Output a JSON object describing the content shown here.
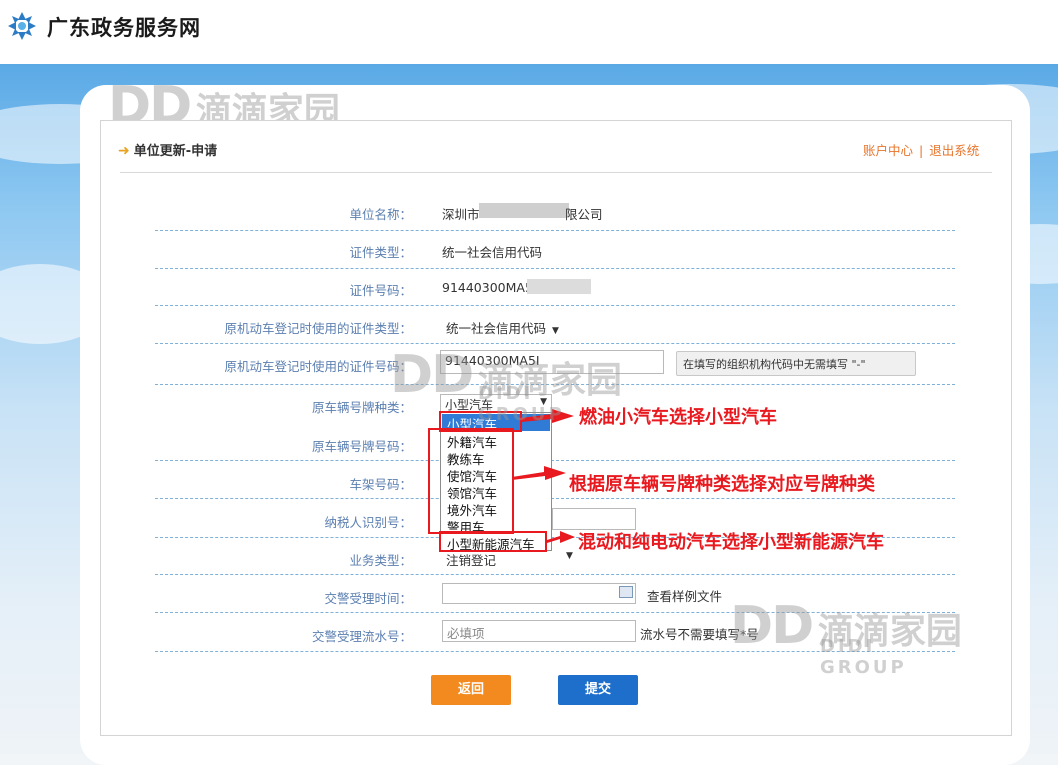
{
  "header": {
    "site_title": "广东政务服务网"
  },
  "page": {
    "title": "单位更新-申请",
    "account_center": "账户中心",
    "separator": "|",
    "logout": "退出系统"
  },
  "form": {
    "unit_name_label": "单位名称：",
    "unit_name_prefix": "深圳市",
    "unit_name_suffix": "限公司",
    "cert_type_label": "证件类型：",
    "cert_type_value": "统一社会信用代码",
    "cert_no_label": "证件号码：",
    "cert_no_value": "91440300MA5",
    "orig_cert_type_label": "原机动车登记时使用的证件类型：",
    "orig_cert_type_value": "统一社会信用代码",
    "orig_cert_no_label": "原机动车登记时使用的证件号码：",
    "orig_cert_no_value": "91440300MA5I",
    "orig_cert_no_hint": "在填写的组织机构代码中无需填写 \"-\"",
    "plate_type_label": "原车辆号牌种类：",
    "plate_type_selected": "小型汽车",
    "plate_no_label": "原车辆号牌号码：",
    "vin_label": "车架号码：",
    "taxpayer_label": "纳税人识别号：",
    "business_type_label": "业务类型：",
    "business_type_value": "注销登记",
    "police_time_label": "交警受理时间：",
    "view_sample": "查看样例文件",
    "police_serial_label": "交警受理流水号：",
    "police_serial_placeholder": "必填项",
    "police_serial_hint": "流水号不需要填写*号"
  },
  "dropdown": {
    "options": [
      "小型汽车",
      "外籍汽车",
      "教练车",
      "使馆汽车",
      "领馆汽车",
      "境外汽车",
      "警用车",
      "小型新能源汽车"
    ],
    "selected_index": 0
  },
  "annotations": {
    "a1": "燃油小汽车选择小型汽车",
    "a2": "根据原车辆号牌种类选择对应号牌种类",
    "a3": "混动和纯电动汽车选择小型新能源汽车"
  },
  "buttons": {
    "back": "返回",
    "submit": "提交"
  },
  "watermark": {
    "letters": "DD",
    "cn": "滴滴家园",
    "en": "DIDI GROUP"
  },
  "colors": {
    "back_button": "#f28a1f",
    "submit_button": "#1e6fcb",
    "annotation": "#e8191f",
    "label": "#5b7fb0"
  }
}
